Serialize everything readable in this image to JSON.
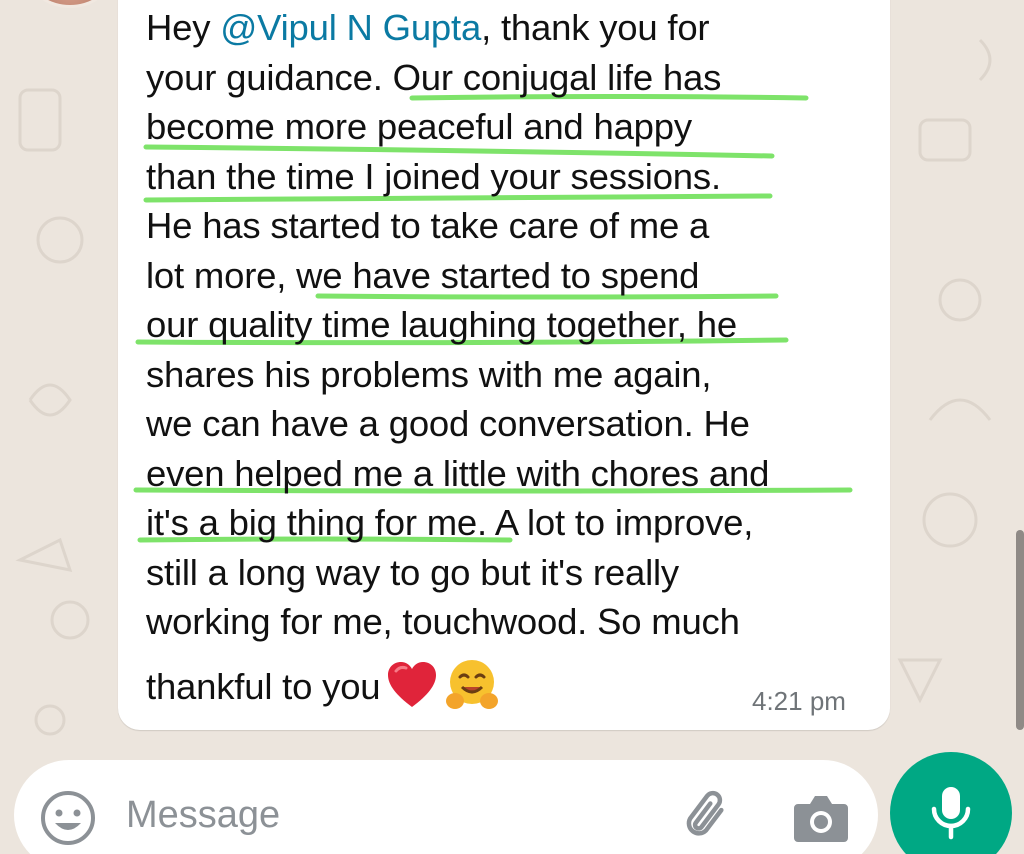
{
  "chat": {
    "message_lines": [
      "your guidance. Our conjugal life has",
      "become more peaceful and happy",
      "than the time I joined your sessions.",
      "He has started to take care of me a",
      "lot more, we have started to spend",
      "our quality time laughing together, he",
      "shares his problems with me again,",
      "we can have a good conversation. He",
      "even helped me a little with chores and",
      "it's a big thing for me. A lot to improve,",
      "still a long way to go but it's really",
      "working for me, touchwood. So much"
    ],
    "greeting": "Hey ",
    "mention": "@Vipul N Gupta",
    "greeting_rest": ", thank you for",
    "last_line": "thankful to you",
    "timestamp": "4:21 pm",
    "emojis": [
      "heart-emoji",
      "hugging-face-emoji"
    ]
  },
  "composer": {
    "placeholder": "Message",
    "icons": [
      "emoji-icon",
      "attach-icon",
      "camera-icon",
      "mic-icon"
    ]
  },
  "colors": {
    "wallpaper": "#ece5dd",
    "bubble": "#ffffff",
    "mention": "#0b7aa3",
    "highlight": "#7ee36a",
    "mic_button": "#00a884"
  }
}
